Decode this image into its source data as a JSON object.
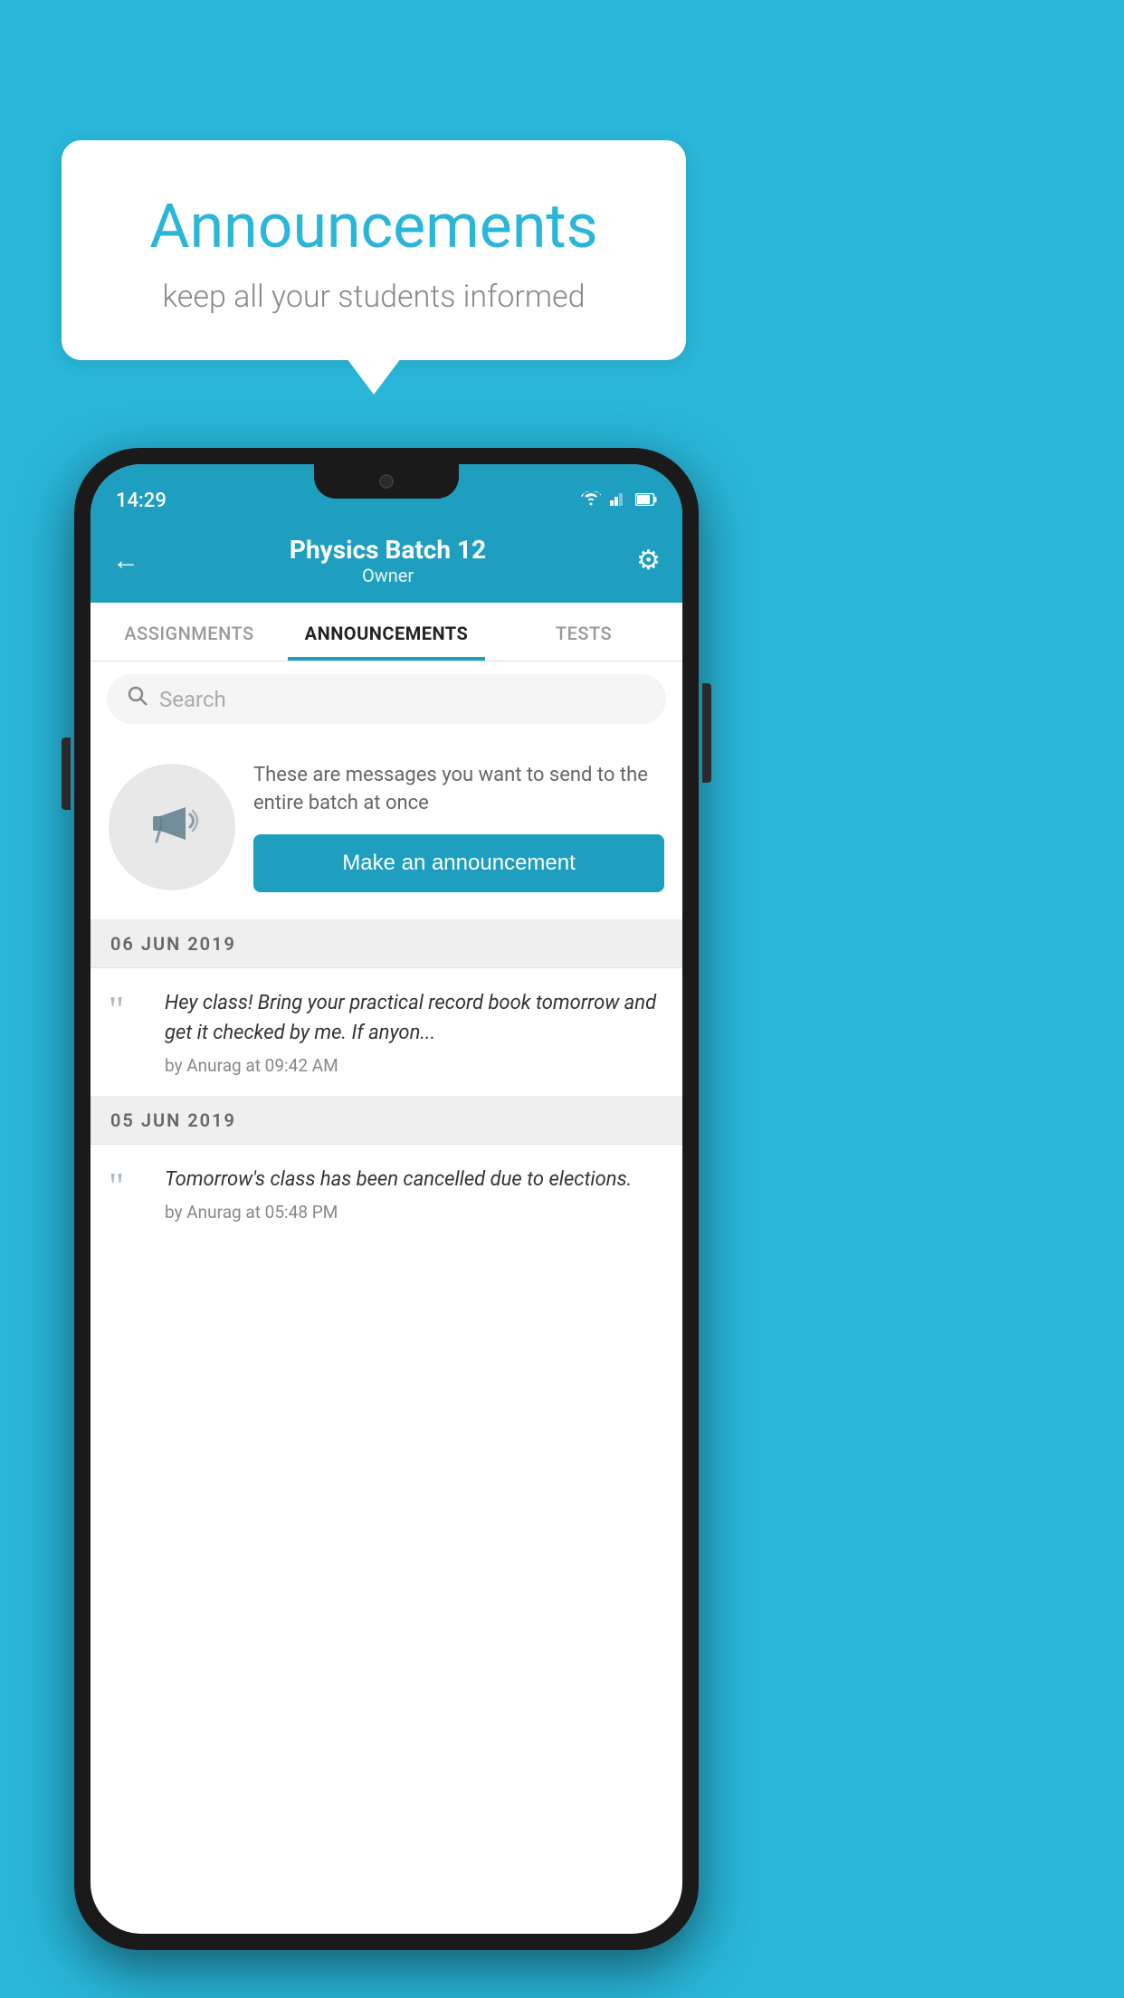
{
  "background_color": "#29b6d8",
  "speech_bubble": {
    "title": "Announcements",
    "subtitle": "keep all your students informed"
  },
  "phone": {
    "status_bar": {
      "time": "14:29"
    },
    "header": {
      "title": "Physics Batch 12",
      "subtitle": "Owner",
      "back_label": "←",
      "gear_label": "⚙"
    },
    "tabs": [
      {
        "label": "ASSIGNMENTS",
        "active": false
      },
      {
        "label": "ANNOUNCEMENTS",
        "active": true
      },
      {
        "label": "TESTS",
        "active": false
      }
    ],
    "search": {
      "placeholder": "Search"
    },
    "announcement_prompt": {
      "description": "These are messages you want to send to the entire batch at once",
      "button_label": "Make an announcement"
    },
    "announcements": [
      {
        "date": "06  JUN  2019",
        "text": "Hey class! Bring your practical record book tomorrow and get it checked by me. If anyon...",
        "meta": "by Anurag at 09:42 AM"
      },
      {
        "date": "05  JUN  2019",
        "text": "Tomorrow's class has been cancelled due to elections.",
        "meta": "by Anurag at 05:48 PM"
      }
    ]
  }
}
